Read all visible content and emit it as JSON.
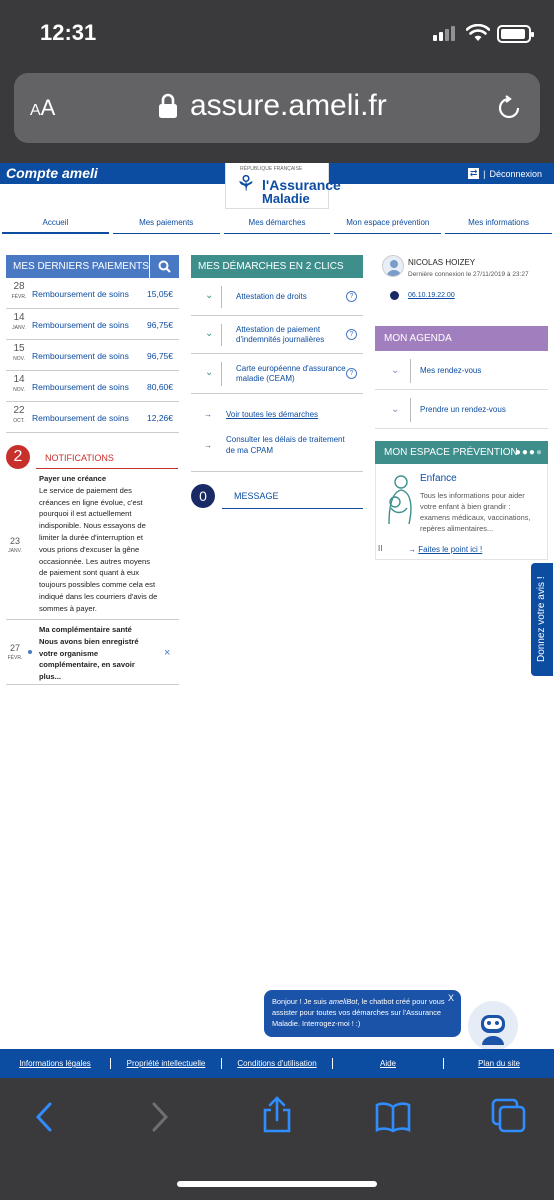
{
  "status": {
    "time": "12:31"
  },
  "browser": {
    "aa_small": "A",
    "aa_large": "A",
    "url": "assure.ameli.fr"
  },
  "header": {
    "brand": "Compte ameli",
    "logout": "Déconnexion",
    "logo_line1": "l'Assurance",
    "logo_line2": "Maladie",
    "logo_small": "RÉPUBLIQUE FRANÇAISE"
  },
  "nav": [
    {
      "label": "Accueil"
    },
    {
      "label": "Mes paiements"
    },
    {
      "label": "Mes démarches"
    },
    {
      "label": "Mon espace prévention"
    },
    {
      "label": "Mes informations"
    }
  ],
  "payments": {
    "title": "MES DERNIERS PAIEMENTS",
    "rows": [
      {
        "day": "28",
        "month": "FÉVR.",
        "label": "Remboursement de soins",
        "amount": "15,05€"
      },
      {
        "day": "14",
        "month": "JANV.",
        "label": "Remboursement de soins",
        "amount": "96,75€"
      },
      {
        "day": "15",
        "month": "NOV.",
        "label": "Remboursement de soins",
        "amount": "96,75€"
      },
      {
        "day": "14",
        "month": "NOV.",
        "label": "Remboursement de soins",
        "amount": "80,60€"
      },
      {
        "day": "22",
        "month": "OCT.",
        "label": "Remboursement de soins",
        "amount": "12,26€"
      }
    ]
  },
  "notifications": {
    "count": "2",
    "title": "NOTIFICATIONS",
    "items": [
      {
        "day": "23",
        "month": "JANV.",
        "heading": "Payer une créance",
        "lines": [
          "Le service de paiement des",
          "créances en ligne évolue, c'est",
          "pourquoi il est actuellement",
          "indisponible. Nous essayons de",
          "limiter la durée d'interruption et",
          "vous prions d'excuser la gêne",
          "occasionnée. Les autres moyens",
          "de paiement sont quant à eux",
          "toujours possibles comme cela est",
          "indiqué dans les courriers d'avis de",
          "sommes à payer."
        ]
      },
      {
        "day": "27",
        "month": "FÉVR.",
        "heading": "Ma complémentaire santé",
        "lines": [
          "Nous avons bien enregistré",
          "votre organisme",
          "complémentaire, en savoir",
          "plus..."
        ],
        "close": "×"
      }
    ]
  },
  "demarches": {
    "title": "MES DÉMARCHES EN 2 CLICS",
    "items": [
      {
        "lines": [
          "Attestation de droits"
        ],
        "help": "?"
      },
      {
        "lines": [
          "Attestation de paiement",
          "d'indemnités journalières"
        ],
        "help": "?"
      },
      {
        "lines": [
          "Carte européenne d'assurance",
          "maladie (CEAM)"
        ],
        "help": "?"
      }
    ],
    "link_all": "Voir toutes les démarches",
    "link_delays_1": "Consulter les délais de traitement",
    "link_delays_2": "de ma CPAM"
  },
  "messages": {
    "count": "0",
    "title": "MESSAGE"
  },
  "profile": {
    "name": "NICOLAS HOIZEY",
    "last_login": "Dernière connexion le 27/11/2019 à 23:27",
    "phone": "06.10.19.22.00"
  },
  "agenda": {
    "title": "MON AGENDA",
    "items": [
      {
        "label": "Mes rendez-vous"
      },
      {
        "label": "Prendre un rendez-vous"
      }
    ]
  },
  "prevention": {
    "title": "MON ESPACE PRÉVENTION",
    "card_title": "Enfance",
    "card_lines": [
      "Tous les informations pour aider",
      "votre enfant à bien grandir :",
      "examens médicaux, vaccinations,",
      "repères alimentaires..."
    ],
    "link": "Faites le point ici !",
    "pause": "II"
  },
  "feedback_tab": "Donnez votre avis !",
  "chatbot": {
    "pre": "Bonjour ! Je suis ",
    "name": "ameliBot",
    "post": ", le chatbot créé pour vous assister pour toutes vos démarches sur l'Assurance Maladie. Interrogez-moi ! :)",
    "close": "X"
  },
  "footer": [
    {
      "label": "Informations légales"
    },
    {
      "label": "Propriété intellectuelle"
    },
    {
      "label": "Conditions d'utilisation"
    },
    {
      "label": "Aide"
    },
    {
      "label": "Plan du site"
    }
  ]
}
